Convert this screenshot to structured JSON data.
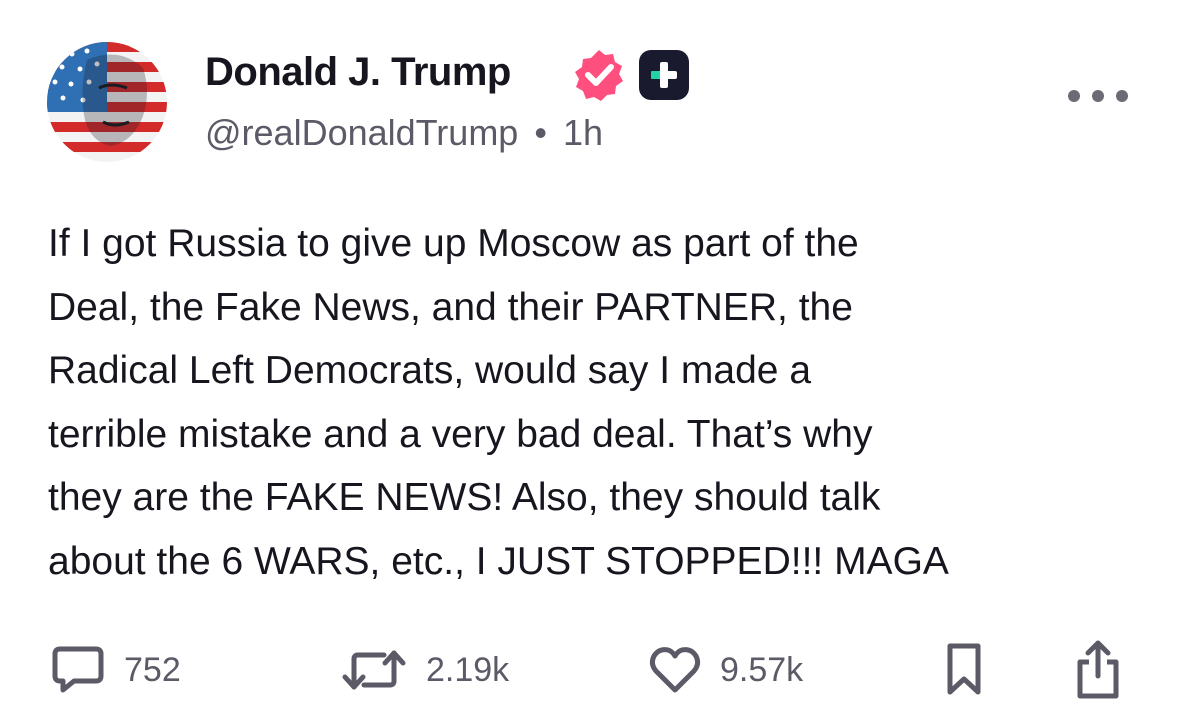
{
  "author": {
    "display_name": "Donald J. Trump",
    "handle": "@realDonaldTrump",
    "separator": "•",
    "time_ago": "1h",
    "verified_icon": "verified-badge-icon",
    "subscription_icon": "plus-badge-icon",
    "avatar_icon": "flag-portrait-avatar"
  },
  "post": {
    "lines": [
      "If I got Russia to give up Moscow as part of the",
      "Deal, the Fake News, and their PARTNER, the",
      "Radical Left Democrats, would say I made a",
      "terrible mistake and a very bad deal. That’s why",
      "they are the FAKE NEWS! Also, they should talk",
      "about the 6 WARS, etc., I JUST STOPPED!!! MAGA"
    ]
  },
  "actions": {
    "replies": "752",
    "reposts": "2.19k",
    "likes": "9.57k"
  },
  "colors": {
    "text": "#17161f",
    "secondary": "#5b5a66",
    "verified": "#ff4f7e",
    "plus_badge_bg": "#1a1a2e",
    "plus_badge_accent": "#22d3a5"
  }
}
